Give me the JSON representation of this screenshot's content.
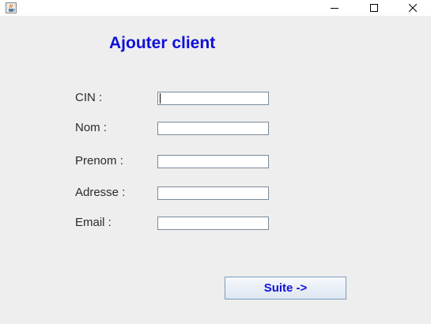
{
  "window": {
    "app_icon": "java-cup-icon",
    "controls": {
      "minimize_icon": "minimize-icon",
      "maximize_icon": "maximize-icon",
      "close_icon": "close-icon"
    }
  },
  "form": {
    "title": "Ajouter client",
    "fields": [
      {
        "label": "CIN :",
        "value": ""
      },
      {
        "label": "Nom :",
        "value": ""
      },
      {
        "label": "Prenom :",
        "value": ""
      },
      {
        "label": "Adresse :",
        "value": ""
      },
      {
        "label": "Email :",
        "value": ""
      }
    ],
    "submit_label": "Suite ->"
  },
  "colors": {
    "title": "#1010d8",
    "button_text": "#1010d8",
    "background": "#eeeeee"
  }
}
